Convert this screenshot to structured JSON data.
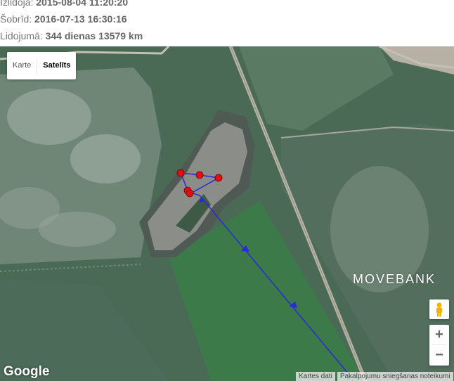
{
  "info": {
    "line1_label": "Izlidoja:",
    "line1_value": "2015-08-04 11:20:20",
    "line2_label": "Šobrīd:",
    "line2_value": "2016-07-13 16:30:16",
    "line3_label": "Lidojumā:",
    "line3_value": "344 dienas 13579 km"
  },
  "map": {
    "maptype_buttons": [
      "Karte",
      "Satelīts"
    ],
    "active_maptype": "Satelīts",
    "watermark": "MOVEBANK",
    "google_logo": "Google",
    "attribution": [
      "Kartes dati",
      "Pakalpojumu sniegšanas noteikumi"
    ],
    "zoom_in": "+",
    "zoom_out": "−",
    "track_color": "#2a2ad6",
    "point_color": "#e01010",
    "icons": [
      "pegman-icon",
      "zoom-in-icon",
      "zoom-out-icon"
    ]
  }
}
